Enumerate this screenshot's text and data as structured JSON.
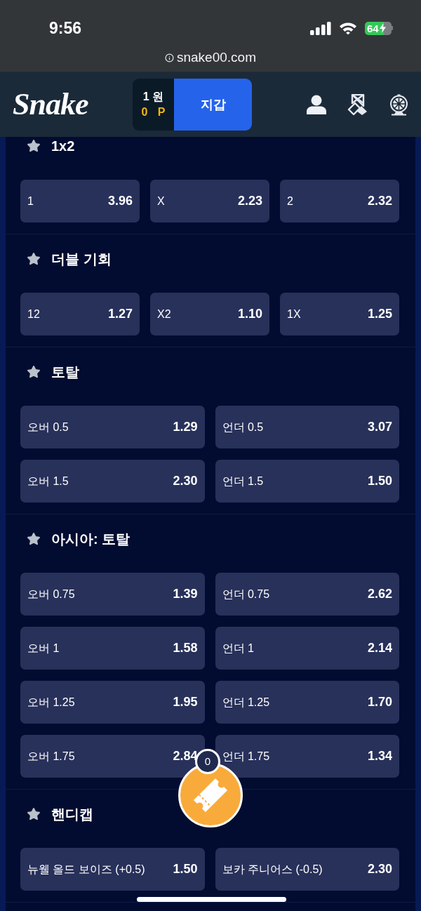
{
  "status_bar": {
    "time": "9:56",
    "battery": "64"
  },
  "browser": {
    "url": "snake00.com"
  },
  "header": {
    "logo": "Snake",
    "wallet": {
      "balance": "1 원",
      "points": "0 P",
      "button": "지갑"
    }
  },
  "markets": [
    {
      "title": "1x2",
      "kind": "threeway",
      "outcomes": [
        {
          "label": "1",
          "odds": "3.96"
        },
        {
          "label": "X",
          "odds": "2.23"
        },
        {
          "label": "2",
          "odds": "2.32"
        }
      ]
    },
    {
      "title": "더블 기회",
      "kind": "threeway",
      "outcomes": [
        {
          "label": "12",
          "odds": "1.27"
        },
        {
          "label": "X2",
          "odds": "1.10"
        },
        {
          "label": "1X",
          "odds": "1.25"
        }
      ]
    },
    {
      "title": "토탈",
      "kind": "twoway",
      "outcomes": [
        {
          "label": "오버 0.5",
          "odds": "1.29"
        },
        {
          "label": "언더 0.5",
          "odds": "3.07"
        },
        {
          "label": "오버 1.5",
          "odds": "2.30"
        },
        {
          "label": "언더 1.5",
          "odds": "1.50"
        }
      ]
    },
    {
      "title": "아시아: 토탈",
      "kind": "twoway",
      "outcomes": [
        {
          "label": "오버 0.75",
          "odds": "1.39"
        },
        {
          "label": "언더 0.75",
          "odds": "2.62"
        },
        {
          "label": "오버 1",
          "odds": "1.58"
        },
        {
          "label": "언더 1",
          "odds": "2.14"
        },
        {
          "label": "오버 1.25",
          "odds": "1.95"
        },
        {
          "label": "언더 1.25",
          "odds": "1.70"
        },
        {
          "label": "오버 1.75",
          "odds": "2.84"
        },
        {
          "label": "언더 1.75",
          "odds": "1.34"
        }
      ]
    },
    {
      "title": "핸디캡",
      "kind": "twoway",
      "outcomes": [
        {
          "label": "뉴웰 올드 보이즈 (+0.5)",
          "odds": "1.50"
        },
        {
          "label": "보카 주니어스 (-0.5)",
          "odds": "2.30"
        }
      ]
    }
  ],
  "bet_slip": {
    "count": "0"
  }
}
